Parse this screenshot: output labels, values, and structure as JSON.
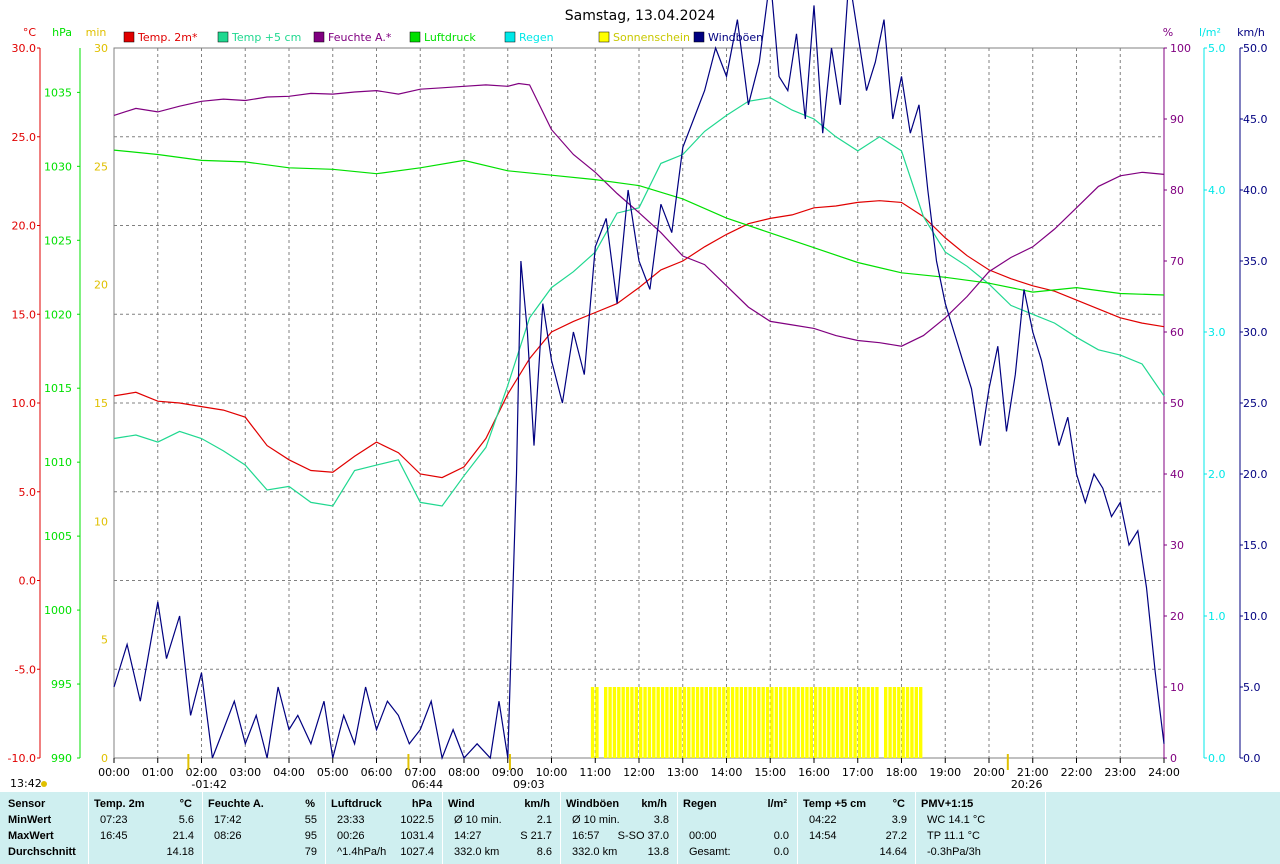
{
  "title": "Samstag, 13.04.2024",
  "colors": {
    "temp2m": "#e00000",
    "temp5cm": "#20d890",
    "humidity": "#800080",
    "pressure": "#00e000",
    "rain": "#00e8e8",
    "sun": "#ffff00",
    "gusts": "#000080",
    "grid": "#808080",
    "table_bg": "#cfeff0"
  },
  "chart_data": {
    "type": "line",
    "x_unit": "hour",
    "xlim": [
      0,
      24
    ],
    "x_ticks": [
      "00:00",
      "01:00",
      "02:00",
      "03:00",
      "04:00",
      "05:00",
      "06:00",
      "07:00",
      "08:00",
      "09:00",
      "10:00",
      "11:00",
      "12:00",
      "13:00",
      "14:00",
      "15:00",
      "16:00",
      "17:00",
      "18:00",
      "19:00",
      "20:00",
      "21:00",
      "22:00",
      "23:00",
      "24:00"
    ],
    "grid": true,
    "legend": [
      "Temp. 2m*",
      "Temp +5 cm",
      "Feuchte A.*",
      "Luftdruck",
      "Regen",
      "Sonnenschein",
      "Windböen"
    ],
    "axes": {
      "temp": {
        "unit": "°C",
        "ylim": [
          -10,
          30
        ],
        "ticks": [
          "30.0",
          "25.0",
          "20.0",
          "15.0",
          "10.0",
          "5.0",
          "0.0",
          "-5.0",
          "-10.0"
        ]
      },
      "pressure": {
        "unit": "hPa",
        "ylim": [
          990,
          1038
        ],
        "ticks": [
          "1035",
          "1030",
          "1025",
          "1020",
          "1015",
          "1010",
          "1005",
          "1000",
          "995",
          "990"
        ]
      },
      "sun_min": {
        "unit": "min",
        "ylim": [
          0,
          30
        ],
        "ticks": [
          "30",
          "25",
          "20",
          "15",
          "10",
          "5",
          "0"
        ]
      },
      "humidity": {
        "unit": "%",
        "ylim": [
          0,
          100
        ],
        "ticks": [
          "100",
          "90",
          "80",
          "70",
          "60",
          "50",
          "40",
          "30",
          "20",
          "10",
          "0"
        ]
      },
      "rain": {
        "unit": "l/m²",
        "ylim": [
          0,
          5
        ],
        "ticks": [
          "5.0",
          "4.0",
          "3.0",
          "2.0",
          "1.0",
          "0.0"
        ]
      },
      "wind": {
        "unit": "km/h",
        "ylim": [
          0,
          50
        ],
        "ticks": [
          "50.0",
          "45.0",
          "40.0",
          "35.0",
          "30.0",
          "25.0",
          "20.0",
          "15.0",
          "10.0",
          "5.0",
          "0.0"
        ]
      }
    },
    "series": [
      {
        "name": "Temp. 2m*",
        "axis": "temp",
        "x": [
          0,
          0.5,
          1,
          1.5,
          2,
          2.5,
          3,
          3.5,
          4,
          4.5,
          5,
          5.5,
          6,
          6.5,
          7,
          7.5,
          8,
          8.5,
          9,
          9.5,
          10,
          10.5,
          11,
          11.5,
          12,
          12.5,
          13,
          13.5,
          14,
          14.5,
          15,
          15.5,
          16,
          16.5,
          17,
          17.5,
          18,
          18.5,
          19,
          19.5,
          20,
          20.5,
          21,
          21.5,
          22,
          22.5,
          23,
          23.5,
          24
        ],
        "y": [
          10.4,
          10.6,
          10.1,
          10.0,
          9.8,
          9.6,
          9.2,
          7.6,
          6.8,
          6.2,
          6.1,
          7.0,
          7.8,
          7.2,
          6.0,
          5.8,
          6.4,
          8.0,
          10.5,
          12.5,
          14.0,
          14.6,
          15.1,
          15.6,
          16.5,
          17.5,
          18.0,
          18.8,
          19.5,
          20.1,
          20.4,
          20.6,
          21.0,
          21.1,
          21.3,
          21.4,
          21.3,
          20.5,
          19.3,
          18.3,
          17.5,
          17.0,
          16.6,
          16.3,
          15.8,
          15.3,
          14.8,
          14.5,
          14.3
        ]
      },
      {
        "name": "Temp +5 cm",
        "axis": "temp",
        "x": [
          0,
          0.5,
          1,
          1.5,
          2,
          2.5,
          3,
          3.5,
          4,
          4.5,
          5,
          5.5,
          6,
          6.5,
          7,
          7.5,
          8,
          8.5,
          9,
          9.5,
          10,
          10.5,
          11,
          11.5,
          12,
          12.5,
          13,
          13.5,
          14,
          14.5,
          15,
          15.5,
          16,
          16.5,
          17,
          17.5,
          18,
          18.5,
          19,
          19.5,
          20,
          20.5,
          21,
          21.5,
          22,
          22.5,
          23,
          23.5,
          24
        ],
        "y": [
          8.0,
          8.2,
          7.8,
          8.4,
          8.0,
          7.3,
          6.5,
          5.1,
          5.3,
          4.4,
          4.2,
          6.2,
          6.5,
          6.8,
          4.4,
          4.2,
          5.9,
          7.5,
          11.0,
          14.8,
          16.5,
          17.4,
          18.5,
          20.7,
          21.0,
          23.5,
          24.0,
          25.3,
          26.2,
          27.0,
          27.2,
          26.5,
          26.0,
          25.0,
          24.2,
          25.0,
          24.2,
          20.5,
          18.5,
          17.7,
          16.7,
          15.5,
          15.0,
          14.5,
          13.7,
          13.0,
          12.7,
          12.2,
          10.4
        ]
      },
      {
        "name": "Feuchte A.*",
        "axis": "humidity",
        "x": [
          0,
          0.5,
          1,
          1.5,
          2,
          2.5,
          3,
          3.5,
          4,
          4.5,
          5,
          5.5,
          6,
          6.5,
          7,
          7.5,
          8,
          8.5,
          9,
          9.25,
          9.5,
          10,
          10.5,
          11,
          11.5,
          12,
          12.5,
          13,
          13.5,
          14,
          14.5,
          15,
          15.5,
          16,
          16.5,
          17,
          17.5,
          18,
          18.5,
          19,
          19.5,
          20,
          20.5,
          21,
          21.5,
          22,
          22.5,
          23,
          23.5,
          24
        ],
        "y": [
          90.5,
          91.5,
          91.0,
          91.8,
          92.5,
          92.8,
          92.6,
          93.1,
          93.2,
          93.6,
          93.5,
          93.8,
          94.0,
          93.5,
          94.2,
          94.4,
          94.6,
          94.8,
          94.6,
          95,
          94.8,
          88.5,
          85.0,
          82.5,
          79.5,
          76.8,
          74.0,
          70.7,
          69.5,
          66.5,
          63.5,
          61.5,
          61.0,
          60.5,
          59.5,
          58.8,
          58.5,
          58.0,
          59.5,
          62.0,
          65.0,
          68.5,
          70.5,
          72.0,
          74.5,
          77.5,
          80.5,
          82.0,
          82.5,
          82.2
        ]
      },
      {
        "name": "Luftdruck",
        "axis": "pressure",
        "x": [
          0,
          1,
          2,
          3,
          4,
          5,
          6,
          7,
          8,
          9,
          10,
          11,
          12,
          13,
          14,
          15,
          16,
          17,
          18,
          19,
          20,
          21,
          22,
          23,
          24
        ],
        "y": [
          1031.1,
          1030.8,
          1030.4,
          1030.3,
          1029.9,
          1029.8,
          1029.5,
          1029.9,
          1030.4,
          1029.7,
          1029.4,
          1029.1,
          1028.7,
          1027.8,
          1026.5,
          1025.5,
          1024.5,
          1023.5,
          1022.8,
          1022.5,
          1022.1,
          1021.5,
          1021.8,
          1021.4,
          1021.3
        ]
      },
      {
        "name": "Windböen",
        "axis": "wind",
        "x": [
          0,
          0.3,
          0.6,
          1,
          1.2,
          1.5,
          1.75,
          2,
          2.25,
          2.5,
          2.75,
          3,
          3.25,
          3.5,
          3.75,
          4,
          4.2,
          4.5,
          4.8,
          5,
          5.25,
          5.5,
          5.75,
          6,
          6.25,
          6.5,
          6.75,
          7,
          7.25,
          7.5,
          7.75,
          8,
          8.3,
          8.6,
          8.8,
          9,
          9.1,
          9.2,
          9.3,
          9.45,
          9.6,
          9.8,
          10,
          10.25,
          10.5,
          10.75,
          11,
          11.25,
          11.5,
          11.75,
          12,
          12.25,
          12.5,
          12.75,
          13,
          13.25,
          13.5,
          13.75,
          14,
          14.25,
          14.5,
          14.75,
          15,
          15.2,
          15.4,
          15.6,
          15.8,
          16,
          16.2,
          16.4,
          16.6,
          16.8,
          17,
          17.2,
          17.4,
          17.6,
          17.8,
          18,
          18.2,
          18.4,
          18.6,
          18.8,
          19,
          19.2,
          19.4,
          19.6,
          19.8,
          20,
          20.2,
          20.4,
          20.6,
          20.8,
          21,
          21.2,
          21.4,
          21.6,
          21.8,
          22,
          22.2,
          22.4,
          22.6,
          22.8,
          23,
          23.2,
          23.4,
          23.6,
          23.8,
          24
        ],
        "y": [
          5,
          8,
          4,
          11,
          7,
          10,
          3,
          6,
          0,
          2,
          4,
          1,
          3,
          0,
          5,
          2,
          3,
          1,
          4,
          0,
          3,
          1,
          5,
          2,
          4,
          3,
          1,
          2,
          4,
          0,
          2,
          0,
          1,
          0,
          4,
          0,
          10,
          20,
          35,
          30,
          22,
          32,
          28,
          25,
          30,
          27,
          36,
          38,
          32,
          40,
          35,
          33,
          39,
          37,
          43,
          45,
          47,
          50,
          48,
          52,
          46,
          49,
          55,
          48,
          47,
          51,
          45,
          53,
          44,
          50,
          46,
          55,
          51,
          47,
          49,
          52,
          45,
          48,
          44,
          46,
          40,
          35,
          32,
          30,
          28,
          26,
          22,
          26,
          29,
          23,
          27,
          33,
          30,
          28,
          25,
          22,
          24,
          20,
          18,
          20,
          19,
          17,
          18,
          15,
          16,
          12,
          6,
          1
        ]
      }
    ],
    "sunshine_bars": {
      "name": "Sonnenschein",
      "axis": "sun_min",
      "x_start": 10.9,
      "x_end": 18.45,
      "value": 3.0
    },
    "rain_series": {
      "name": "Regen",
      "axis": "rain",
      "total": 0.0
    },
    "markers": [
      {
        "x": 1.7,
        "label": "-01:42"
      },
      {
        "x": 6.73,
        "label": "06:44"
      },
      {
        "x": 9.05,
        "label": "09:03"
      },
      {
        "x": 20.43,
        "label": "20:26"
      }
    ],
    "corner_time": "13:42"
  },
  "stats": {
    "row_labels": [
      "Sensor",
      "MinWert",
      "MaxWert",
      "Durchschnitt"
    ],
    "columns": [
      {
        "title": "Temp. 2m",
        "unit": "°C",
        "rows": [
          [
            "07:23",
            "5.6"
          ],
          [
            "16:45",
            "21.4"
          ],
          [
            "",
            "14.18"
          ]
        ]
      },
      {
        "title": "Feuchte A.",
        "unit": "%",
        "rows": [
          [
            "17:42",
            "55"
          ],
          [
            "08:26",
            "95"
          ],
          [
            "",
            "79"
          ]
        ]
      },
      {
        "title": "Luftdruck",
        "unit": "hPa",
        "rows": [
          [
            "23:33",
            "1022.5"
          ],
          [
            "00:26",
            "1031.4"
          ],
          [
            "^1.4hPa/h",
            "1027.4"
          ]
        ]
      },
      {
        "title": "Wind",
        "unit": "km/h",
        "rows": [
          [
            "Ø 10 min.",
            "2.1"
          ],
          [
            "14:27",
            "S 21.7"
          ],
          [
            "332.0 km",
            "8.6"
          ]
        ]
      },
      {
        "title": "Windböen",
        "unit": "km/h",
        "rows": [
          [
            "Ø 10 min.",
            "3.8"
          ],
          [
            "16:57",
            "S-SO 37.0"
          ],
          [
            "332.0 km",
            "13.8"
          ]
        ]
      },
      {
        "title": "Regen",
        "unit": "l/m²",
        "rows": [
          [
            "",
            ""
          ],
          [
            "00:00",
            "0.0"
          ],
          [
            "Gesamt:",
            "0.0"
          ]
        ]
      },
      {
        "title": "Temp +5 cm",
        "unit": "°C",
        "rows": [
          [
            "04:22",
            "3.9"
          ],
          [
            "14:54",
            "27.2"
          ],
          [
            "",
            "14.64"
          ]
        ]
      },
      {
        "title": "PMV+1:15",
        "unit": "",
        "rows": [
          [
            "WC 14.1 °C",
            ""
          ],
          [
            "TP 11.1 °C",
            ""
          ],
          [
            "-0.3hPa/3h",
            ""
          ]
        ]
      }
    ]
  }
}
